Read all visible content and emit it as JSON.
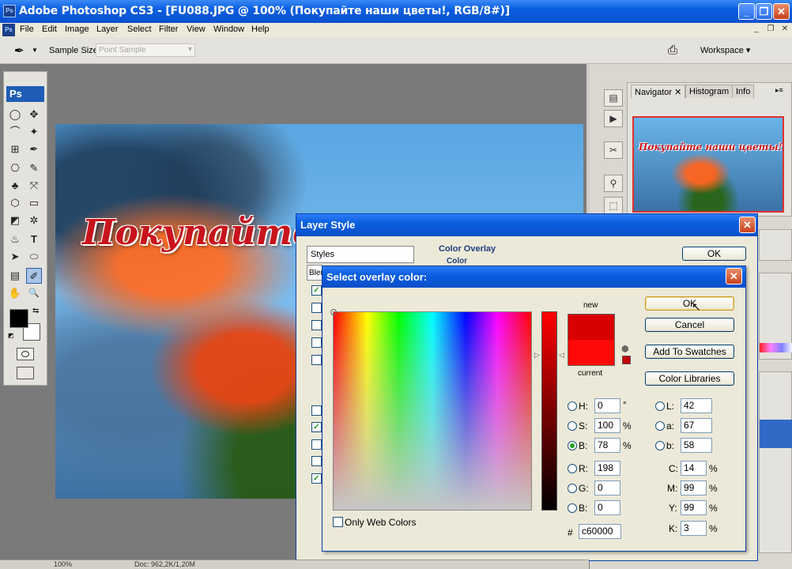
{
  "window": {
    "title": "Adobe Photoshop CS3 - [FU088.JPG @ 100% (Покупайте наши цветы!, RGB/8#)]",
    "app_icon": "Ps",
    "minimize_glyph": "_",
    "maximize_glyph": "❐",
    "close_glyph": "✕"
  },
  "menu": {
    "items": [
      "File",
      "Edit",
      "Image",
      "Layer",
      "Select",
      "Filter",
      "View",
      "Window",
      "Help"
    ],
    "doc_controls": [
      "_",
      "❐",
      "✕"
    ]
  },
  "options": {
    "sample_size_label": "Sample Size:",
    "sample_size_value": "Point Sample",
    "workspace_label": "Workspace ▾"
  },
  "tools": {
    "logo": "Ps",
    "glyphs": [
      "◯",
      "✥",
      "⌒",
      "✦",
      "⊞",
      "✒",
      "⎔",
      "✎",
      "♣",
      "⤧",
      "⬡",
      "▭",
      "◩",
      "✲",
      "♨",
      "●",
      "⌂",
      "T",
      "➤",
      "⬭",
      "▤",
      "✐",
      "✋",
      "🔍"
    ]
  },
  "document": {
    "headline": "Покупайте"
  },
  "navigator": {
    "tabs": [
      "Navigator",
      "Histogram",
      "Info"
    ],
    "thumb_text": "Покупайте наши цветы!"
  },
  "layer_style": {
    "title": "Layer Style",
    "styles_header": "Styles",
    "blend_label": "Blen",
    "section_title": "Color Overlay",
    "section_sub": "Color",
    "ok": "OK"
  },
  "color_picker": {
    "title": "Select overlay color:",
    "new_label": "new",
    "current_label": "current",
    "ok": "OK",
    "cancel": "Cancel",
    "add_swatches": "Add To Swatches",
    "color_libraries": "Color Libraries",
    "only_web": "Only Web Colors",
    "new_color": "#d80000",
    "current_color": "#ff0808",
    "hsb": {
      "h_label": "H:",
      "h": "0",
      "h_unit": "°",
      "s_label": "S:",
      "s": "100",
      "s_unit": "%",
      "b_label": "B:",
      "b": "78",
      "b_unit": "%"
    },
    "rgb": {
      "r_label": "R:",
      "r": "198",
      "g_label": "G:",
      "g": "0",
      "b_label": "B:",
      "b": "0"
    },
    "lab": {
      "l_label": "L:",
      "l": "42",
      "a_label": "a:",
      "a": "67",
      "b_label": "b:",
      "b": "58"
    },
    "cmyk": {
      "c_label": "C:",
      "c": "14",
      "m_label": "M:",
      "m": "99",
      "y_label": "Y:",
      "y": "99",
      "k_label": "K:",
      "k": "3",
      "unit": "%"
    },
    "hex_label": "#",
    "hex": "c60000"
  },
  "status": {
    "zoom": "100%",
    "doc": "Doc: 962,2K/1,20M"
  }
}
